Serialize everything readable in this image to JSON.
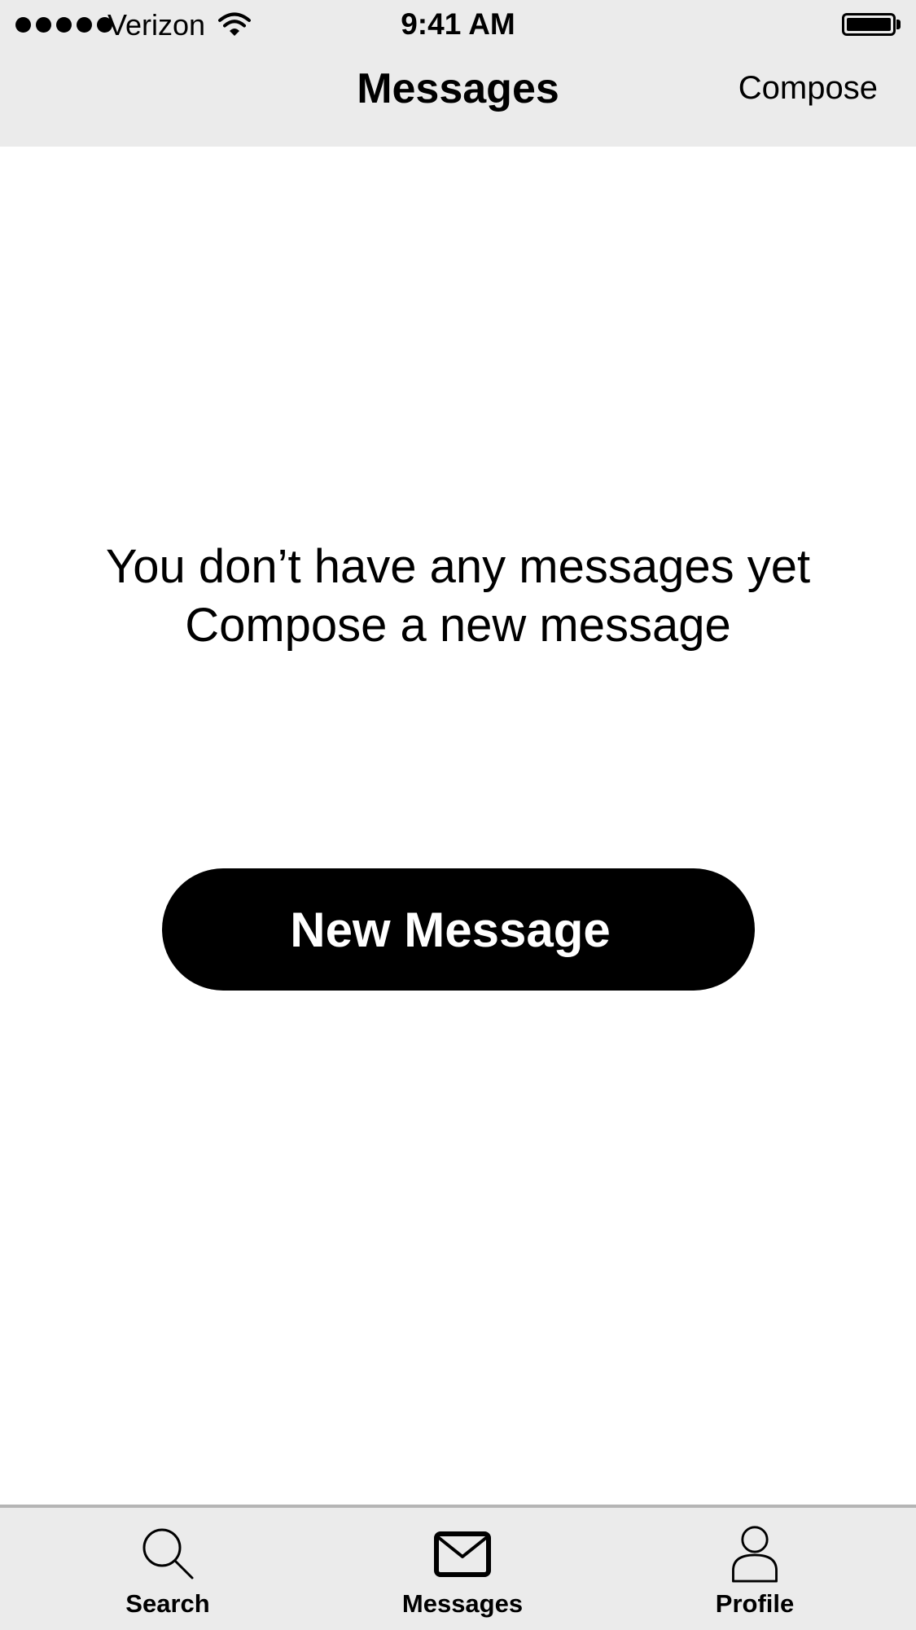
{
  "status_bar": {
    "carrier": "Verizon",
    "time": "9:41 AM"
  },
  "nav": {
    "title": "Messages",
    "compose_label": "Compose"
  },
  "empty_state": {
    "line1": "You don’t have any messages yet",
    "line2": "Compose a new message",
    "button_label": "New Message"
  },
  "tabs": [
    {
      "label": "Search",
      "icon": "search-icon"
    },
    {
      "label": "Messages",
      "icon": "envelope-icon"
    },
    {
      "label": "Profile",
      "icon": "person-icon"
    }
  ]
}
